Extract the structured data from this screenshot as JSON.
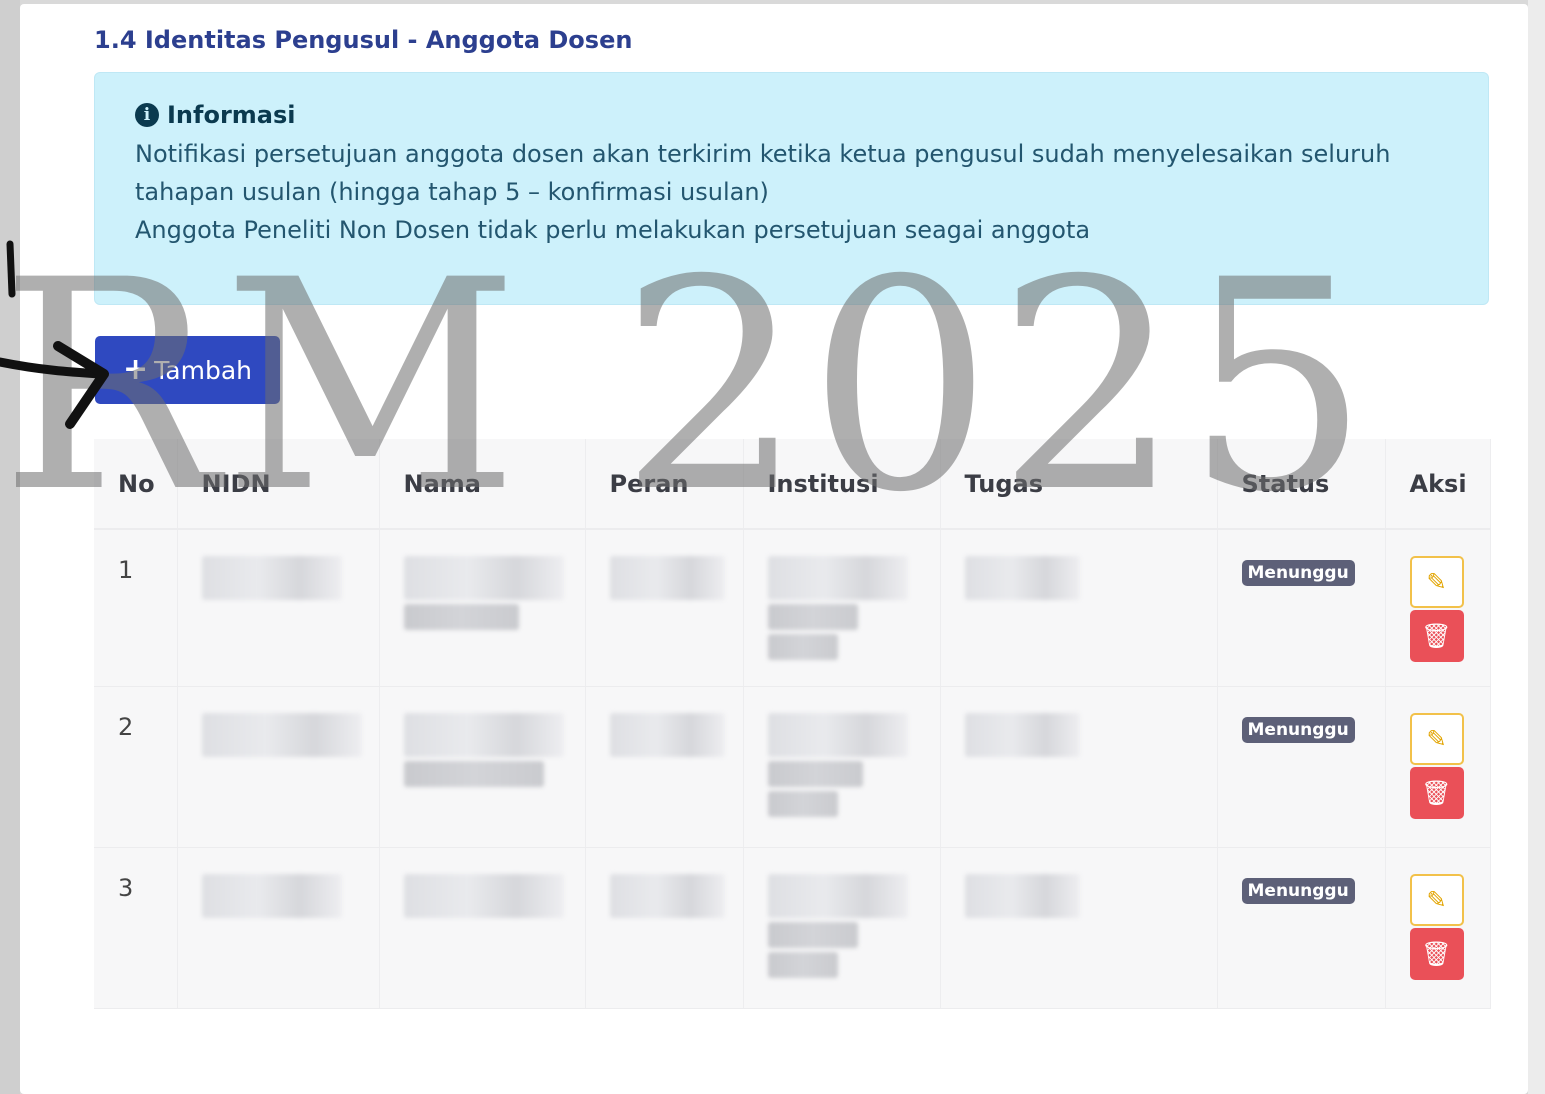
{
  "section": {
    "title": "1.4 Identitas Pengusul - Anggota Dosen"
  },
  "alert": {
    "icon": "info-icon",
    "title": "Informasi",
    "line1": "Notifikasi persetujuan anggota dosen akan terkirim ketika ketua pengusul sudah menyelesaikan seluruh tahapan usulan (hingga tahap 5 – konfirmasi usulan)",
    "line2": "Anggota Peneliti Non Dosen tidak perlu melakukan persetujuan seagai anggota"
  },
  "watermark": "RM 2025",
  "add_button": {
    "icon": "+",
    "label": "Tambah"
  },
  "table": {
    "headers": [
      "No",
      "NIDN",
      "Nama",
      "Peran",
      "Institusi",
      "Tugas",
      "Status",
      "Aksi"
    ],
    "rows": [
      {
        "no": "1",
        "status": "Menunggu"
      },
      {
        "no": "2",
        "status": "Menunggu"
      },
      {
        "no": "3",
        "status": "Menunggu"
      }
    ]
  },
  "icons": {
    "edit": "pencil-icon",
    "delete": "trash-icon"
  },
  "colors": {
    "primary": "#2f49c0",
    "info_bg": "#cdf1fb",
    "badge": "#5d6078",
    "danger": "#ea5058",
    "warning": "#f2c14a"
  }
}
